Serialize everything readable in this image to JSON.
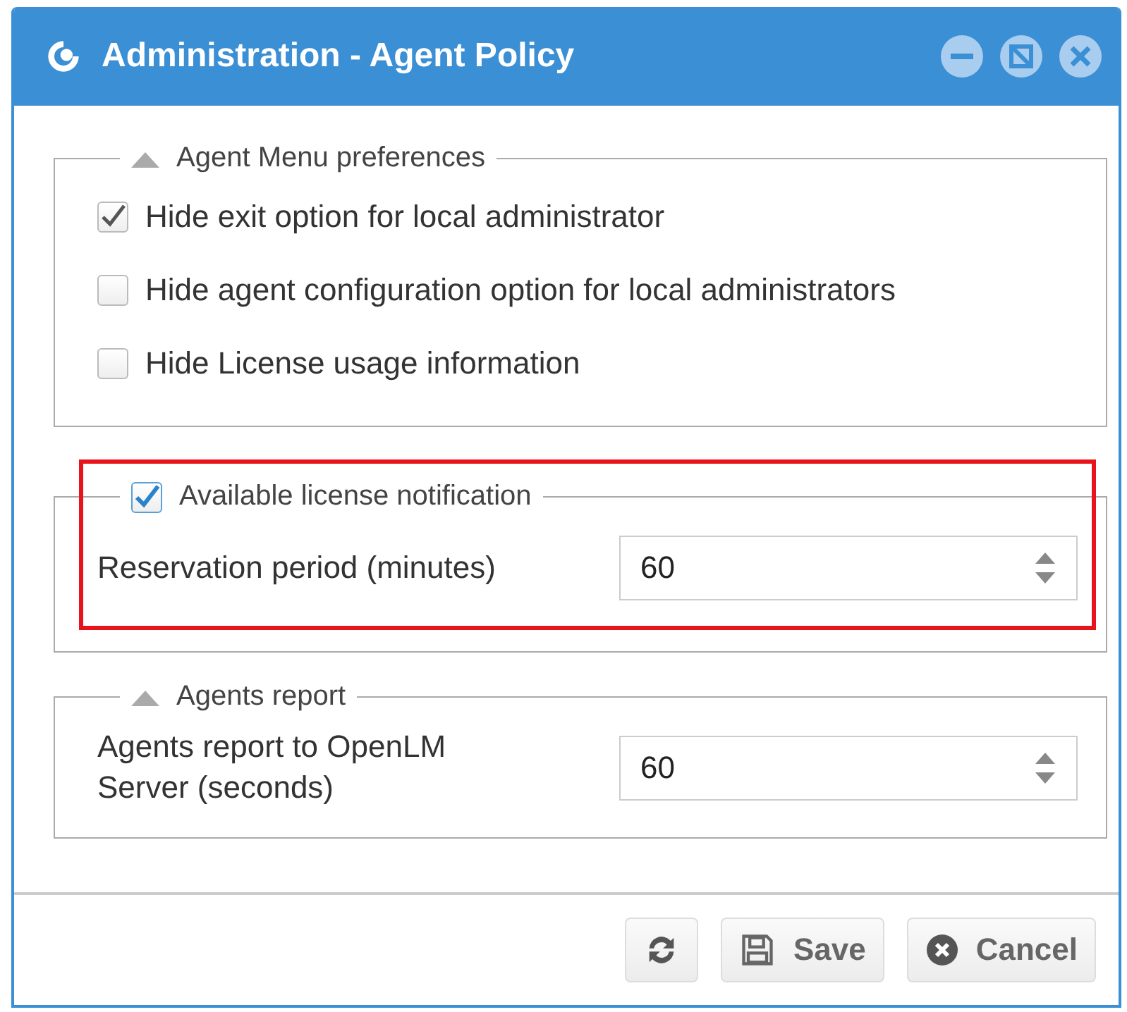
{
  "window": {
    "title": "Administration - Agent Policy"
  },
  "sections": [
    {
      "kind": "collapsible",
      "title": "Agent Menu preferences",
      "expanded": true,
      "highlighted": false,
      "options": [
        {
          "label": "Hide exit option for local administrator",
          "checked": true
        },
        {
          "label": "Hide agent configuration option for local administrators",
          "checked": false
        },
        {
          "label": "Hide License usage information",
          "checked": false
        }
      ]
    },
    {
      "kind": "checkbox",
      "title": "Available license notification",
      "checked": true,
      "highlighted": true,
      "fields": [
        {
          "label": "Reservation period (minutes)",
          "value": "60"
        }
      ]
    },
    {
      "kind": "collapsible",
      "title": "Agents report",
      "expanded": true,
      "highlighted": false,
      "fields": [
        {
          "label": "Agents report to OpenLM Server (seconds)",
          "value": "60"
        }
      ]
    }
  ],
  "buttons": [
    {
      "kind": "refresh"
    },
    {
      "kind": "save",
      "label": "Save"
    },
    {
      "kind": "cancel",
      "label": "Cancel"
    }
  ]
}
